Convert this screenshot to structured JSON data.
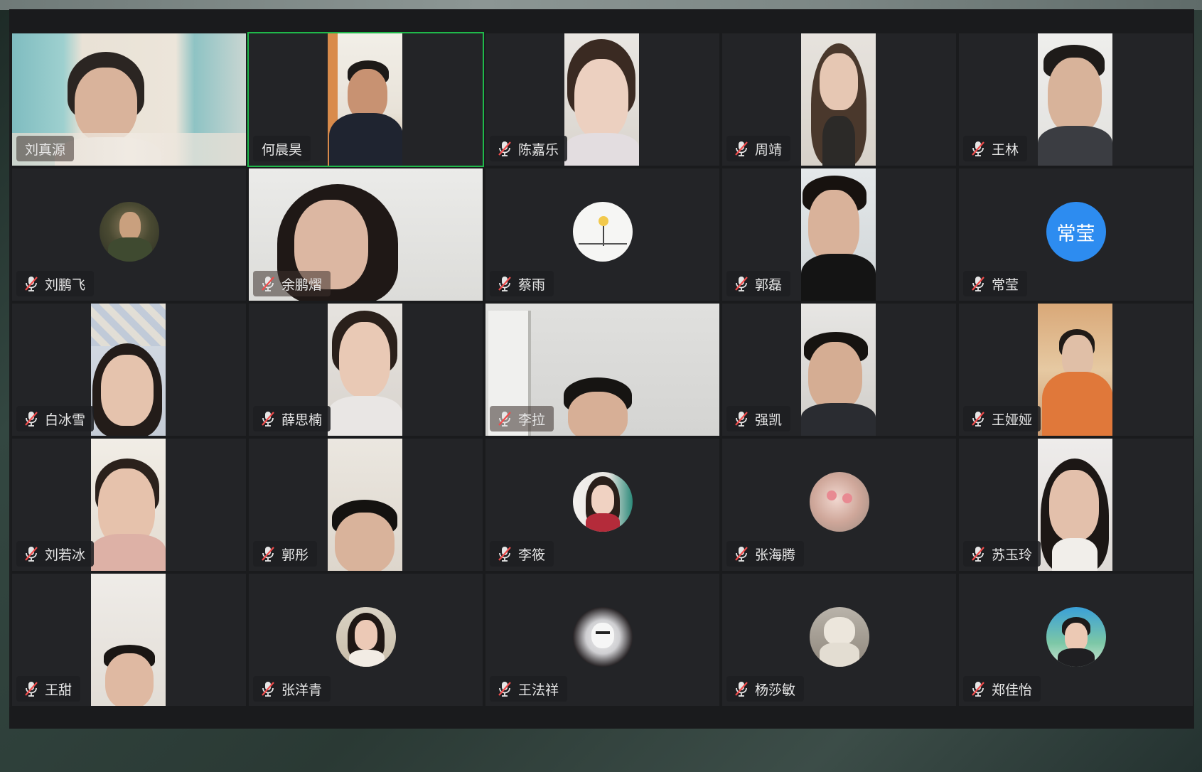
{
  "meeting": {
    "participants": [
      {
        "name": "刘真源",
        "muted": false,
        "active": false,
        "kind": "video-full"
      },
      {
        "name": "何晨昊",
        "muted": false,
        "active": true,
        "kind": "video-strip"
      },
      {
        "name": "陈嘉乐",
        "muted": true,
        "active": false,
        "kind": "video-strip"
      },
      {
        "name": "周靖",
        "muted": true,
        "active": false,
        "kind": "video-strip"
      },
      {
        "name": "王林",
        "muted": true,
        "active": false,
        "kind": "video-strip"
      },
      {
        "name": "刘鹏飞",
        "muted": true,
        "active": false,
        "kind": "avatar-photo"
      },
      {
        "name": "余鹏熠",
        "muted": true,
        "active": false,
        "kind": "video-full"
      },
      {
        "name": "蔡雨",
        "muted": true,
        "active": false,
        "kind": "avatar-photo"
      },
      {
        "name": "郭磊",
        "muted": true,
        "active": false,
        "kind": "video-strip"
      },
      {
        "name": "常莹",
        "muted": true,
        "active": false,
        "kind": "avatar-text",
        "avatar_text": "常莹"
      },
      {
        "name": "白冰雪",
        "muted": true,
        "active": false,
        "kind": "video-strip"
      },
      {
        "name": "薛思楠",
        "muted": true,
        "active": false,
        "kind": "video-strip"
      },
      {
        "name": "李拉",
        "muted": true,
        "active": false,
        "kind": "video-full"
      },
      {
        "name": "强凯",
        "muted": true,
        "active": false,
        "kind": "video-strip"
      },
      {
        "name": "王娅娅",
        "muted": true,
        "active": false,
        "kind": "video-strip"
      },
      {
        "name": "刘若冰",
        "muted": true,
        "active": false,
        "kind": "video-strip"
      },
      {
        "name": "郭彤",
        "muted": true,
        "active": false,
        "kind": "video-strip"
      },
      {
        "name": "李筱",
        "muted": true,
        "active": false,
        "kind": "avatar-photo"
      },
      {
        "name": "张海腾",
        "muted": true,
        "active": false,
        "kind": "avatar-photo"
      },
      {
        "name": "苏玉玲",
        "muted": true,
        "active": false,
        "kind": "video-strip"
      },
      {
        "name": "王甜",
        "muted": true,
        "active": false,
        "kind": "video-strip"
      },
      {
        "name": "张洋青",
        "muted": true,
        "active": false,
        "kind": "avatar-photo"
      },
      {
        "name": "王法祥",
        "muted": true,
        "active": false,
        "kind": "avatar-photo"
      },
      {
        "name": "杨莎敏",
        "muted": true,
        "active": false,
        "kind": "avatar-photo"
      },
      {
        "name": "郑佳怡",
        "muted": true,
        "active": false,
        "kind": "avatar-photo"
      }
    ],
    "icons": {
      "muted": "mic-off-icon"
    },
    "colors": {
      "active_speaker_border": "#1fb84a",
      "tile_background": "#232427",
      "text_avatar": "#2d8cf0"
    }
  }
}
